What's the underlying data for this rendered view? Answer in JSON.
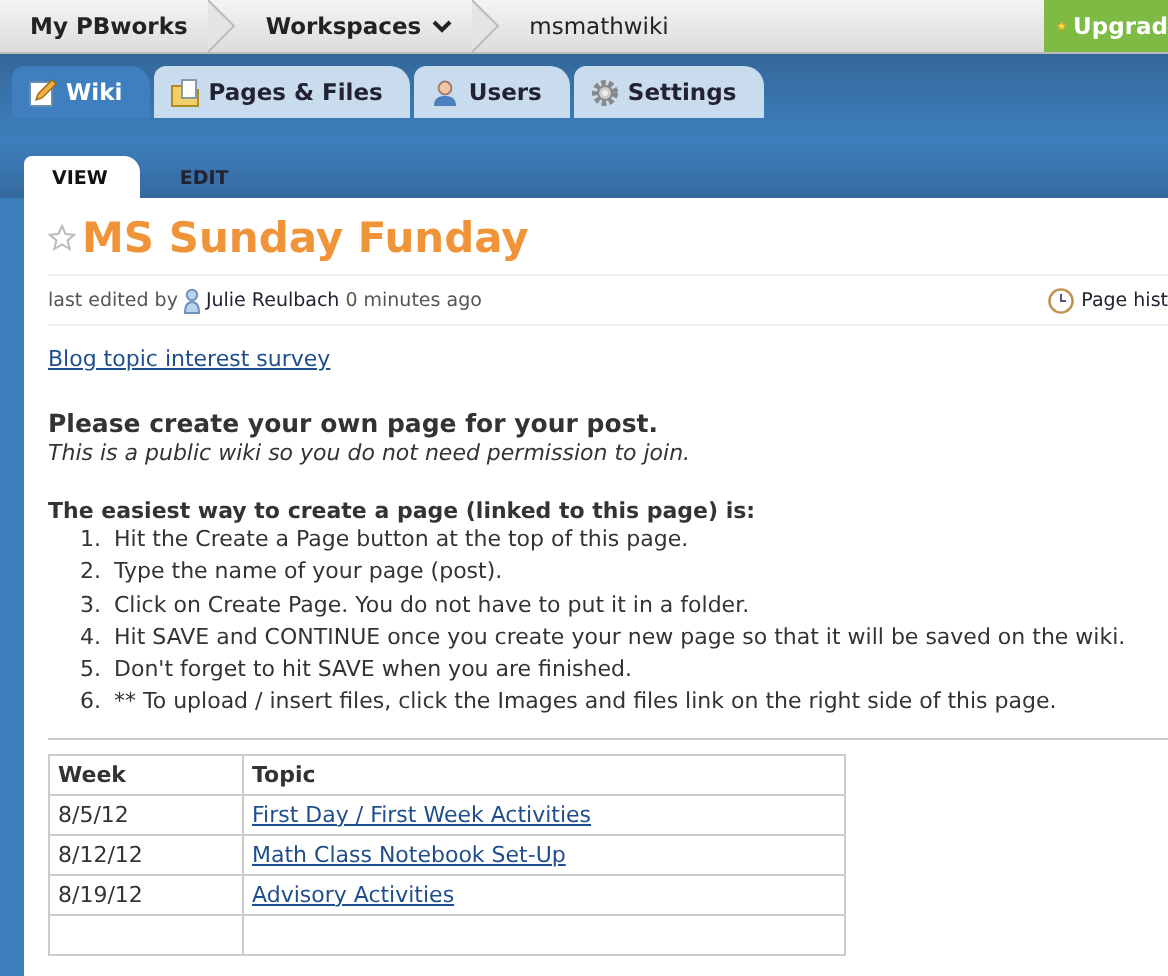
{
  "top_bar": {
    "breadcrumbs": [
      {
        "label": "My PBworks",
        "kind": "link"
      },
      {
        "label": "Workspaces",
        "kind": "menu"
      },
      {
        "label": "msmathwiki",
        "kind": "current"
      }
    ],
    "upgrade_button": "Upgrad"
  },
  "main_tabs": [
    {
      "label": "Wiki",
      "selected": true
    },
    {
      "label": "Pages & Files",
      "selected": false
    },
    {
      "label": "Users",
      "selected": false
    },
    {
      "label": "Settings",
      "selected": false
    }
  ],
  "view_tabs": [
    {
      "label": "VIEW",
      "selected": true
    },
    {
      "label": "EDIT",
      "selected": false
    }
  ],
  "page": {
    "title": "MS Sunday Funday",
    "starred": false,
    "meta": {
      "prefix": "last edited by",
      "author": "Julie Reulbach",
      "time": "0 minutes ago"
    },
    "history_link": "Page hist",
    "link": "Blog topic interest survey",
    "heading": "Please create your own page for your post.",
    "note": "This is a public wiki so you do not need permission to join.",
    "steps_title": "The easiest way to create a page (linked to this page) is:",
    "steps": [
      {
        "number": "1.",
        "text": "Hit the Create a Page button at the top of this page."
      },
      {
        "number": "2.",
        "text": "Type the name of your page (post)."
      },
      {
        "number": "3.",
        "text": "Click on Create Page. You do not have to put it in a folder."
      },
      {
        "number": "4.",
        "text": "Hit SAVE and CONTINUE once you create your new page so that it will be saved on the wiki."
      },
      {
        "number": "5.",
        "text": "Don't forget to hit SAVE when you are finished."
      },
      {
        "number": "6.",
        "text": "** To upload / insert files, click the Images and files link on the right side of this page."
      }
    ],
    "table": {
      "columns": [
        "Week",
        "Topic"
      ],
      "rows": [
        {
          "week": "8/5/12",
          "topic": "First Day / First Week Activities"
        },
        {
          "week": "8/12/12",
          "topic": "Math Class Notebook Set-Up"
        },
        {
          "week": "8/19/12",
          "topic": "Advisory Activities"
        },
        {
          "week": "",
          "topic": ""
        }
      ]
    }
  }
}
